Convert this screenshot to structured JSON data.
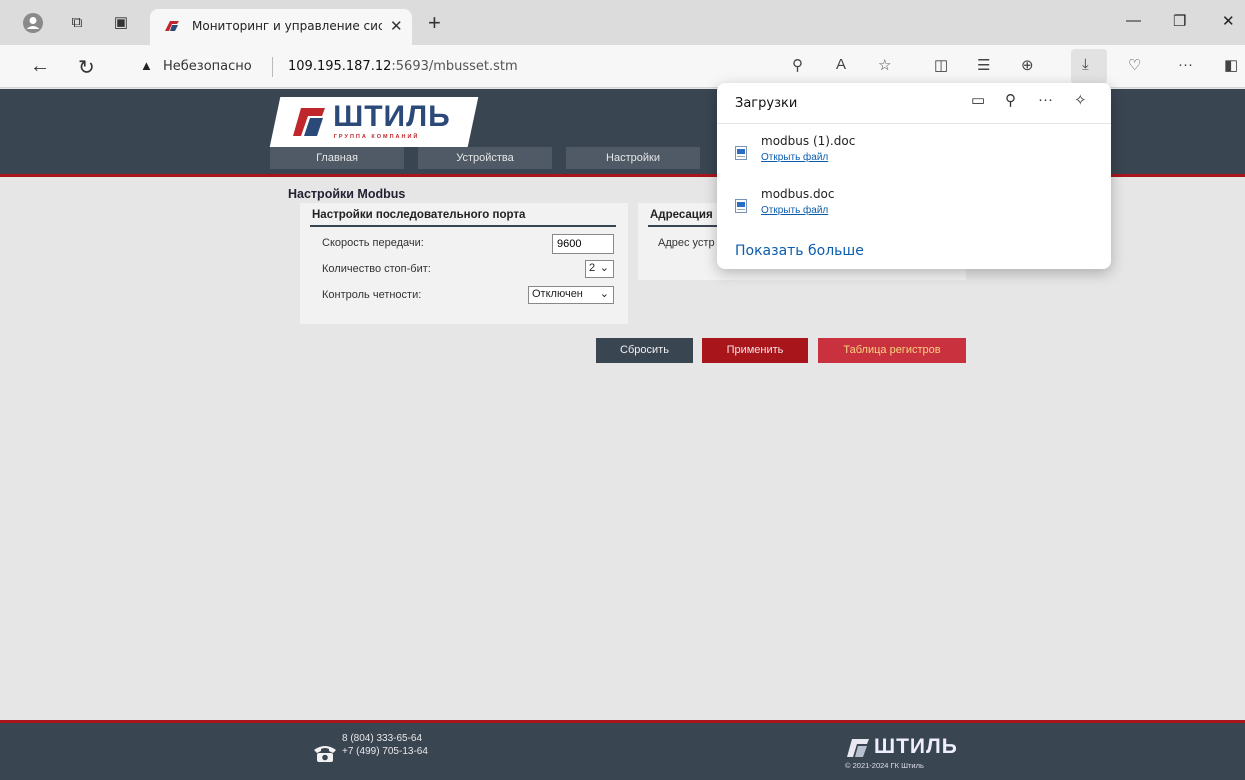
{
  "browser": {
    "tab_title": "Мониторинг и управление сист",
    "new_tab_label": "+",
    "security_label": "Небезопасно",
    "url_host": "109.195.187.12",
    "url_rest": ":5693/mbusset.stm"
  },
  "downloads": {
    "title": "Загрузки",
    "items": [
      {
        "name": "modbus (1).doc",
        "action": "Открыть файл"
      },
      {
        "name": "modbus.doc",
        "action": "Открыть файл"
      }
    ],
    "show_more": "Показать больше"
  },
  "site": {
    "logo_text": "ШТИЛЬ",
    "logo_subtitle": "ГРУППА КОМПАНИЙ",
    "menu": [
      "Главная",
      "Устройства",
      "Настройки"
    ],
    "page_title": "Настройки Modbus",
    "serial": {
      "title": "Настройки последовательного порта",
      "baud_label": "Скорость передачи:",
      "baud_value": "9600",
      "stopbits_label": "Количество стоп-бит:",
      "stopbits_value": "2",
      "parity_label": "Контроль четности:",
      "parity_value": "Отключен"
    },
    "addressing": {
      "title": "Адресация",
      "address_label": "Адрес устр"
    },
    "buttons": {
      "reset": "Сбросить",
      "apply": "Применить",
      "registers": "Таблица регистров"
    },
    "footer": {
      "phone1": "8 (804) 333-65-64",
      "phone2": "+7 (499) 705-13-64",
      "logo_text": "ШТИЛЬ",
      "copyright": "© 2021-2024 ГК Штиль"
    }
  },
  "colors": {
    "header_bg": "#3a4552",
    "accent_red": "#a8161c",
    "button_dark": "#3a4552",
    "button_red": "#a8161c",
    "button_light_red": "#c9313f",
    "link_blue": "#0b5cad"
  }
}
